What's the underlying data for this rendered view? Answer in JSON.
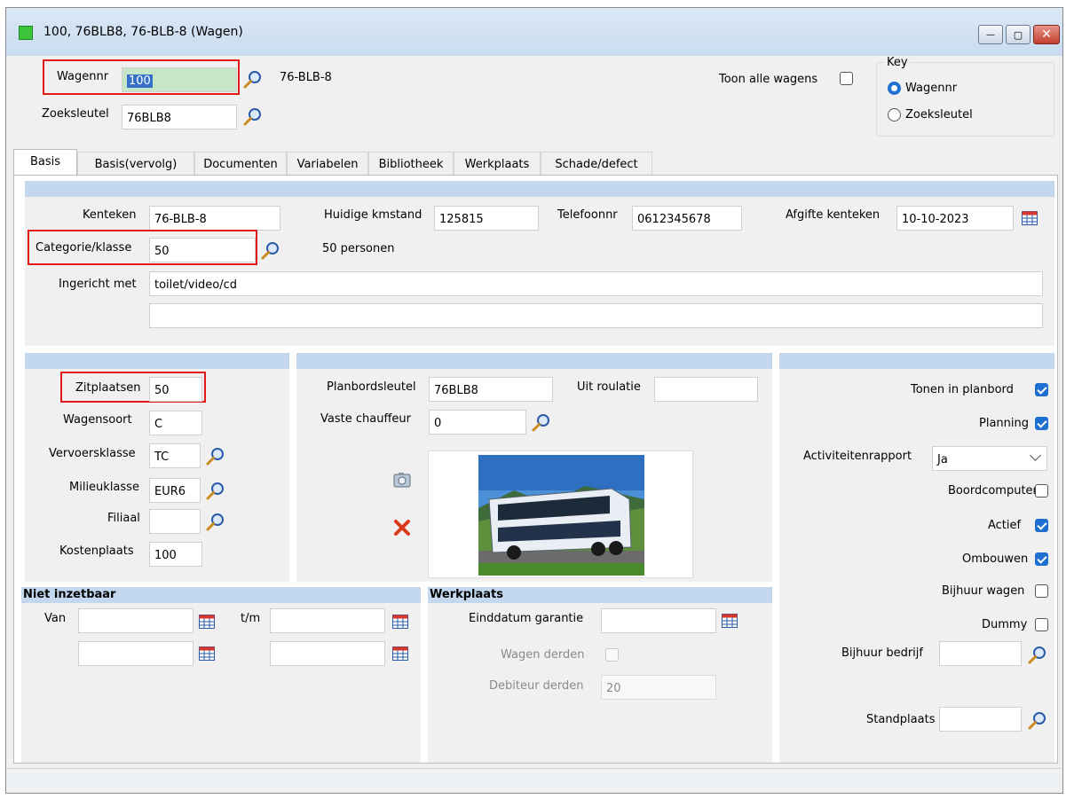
{
  "window": {
    "title": "100, 76BLB8, 76-BLB-8 (Wagen)",
    "minimize_glyph": "—",
    "maximize_glyph": "▢",
    "close_glyph": "✕"
  },
  "header": {
    "wagennr_label": "Wagennr",
    "wagennr_value": "100",
    "kenteken_display": "76-BLB-8",
    "zoeksleutel_label": "Zoeksleutel",
    "zoeksleutel_value": "76BLB8",
    "toon_alle_wagens_label": "Toon alle wagens",
    "toon_alle_wagens_checked": false,
    "key_group_label": "Key",
    "key_options": [
      {
        "label": "Wagennr",
        "selected": true
      },
      {
        "label": "Zoeksleutel",
        "selected": false
      }
    ]
  },
  "tabs": [
    "Basis",
    "Basis(vervolg)",
    "Documenten",
    "Variabelen",
    "Bibliotheek",
    "Werkplaats",
    "Schade/defect"
  ],
  "active_tab": "Basis",
  "top_section": {
    "kenteken_label": "Kenteken",
    "kenteken_value": "76-BLB-8",
    "kmstand_label": "Huidige kmstand",
    "kmstand_value": "125815",
    "telefoonnr_label": "Telefoonnr",
    "telefoonnr_value": "0612345678",
    "afgifte_label": "Afgifte kenteken",
    "afgifte_value": "10-10-2023",
    "categorie_label": "Categorie/klasse",
    "categorie_value": "50",
    "categorie_desc": "50 personen",
    "ingericht_label": "Ingericht met",
    "ingericht_value": "toilet/video/cd",
    "ingericht_value2": ""
  },
  "left_section": {
    "zitplaatsen_label": "Zitplaatsen",
    "zitplaatsen_value": "50",
    "wagensoort_label": "Wagensoort",
    "wagensoort_value": "C",
    "vervoersklasse_label": "Vervoersklasse",
    "vervoersklasse_value": "TC",
    "milieuklasse_label": "Milieuklasse",
    "milieuklasse_value": "EUR6",
    "filiaal_label": "Filiaal",
    "filiaal_value": "",
    "kostenplaats_label": "Kostenplaats",
    "kostenplaats_value": "100"
  },
  "middle_section": {
    "planbordsleutel_label": "Planbordsleutel",
    "planbordsleutel_value": "76BLB8",
    "uit_roulatie_label": "Uit roulatie",
    "uit_roulatie_value": "",
    "vaste_chauffeur_label": "Vaste chauffeur",
    "vaste_chauffeur_value": "0"
  },
  "right_section": {
    "items": [
      {
        "label": "Tonen in planbord",
        "checked": true
      },
      {
        "label": "Planning",
        "checked": true
      }
    ],
    "activiteitenrapport_label": "Activiteitenrapport",
    "activiteitenrapport_value": "Ja",
    "items2": [
      {
        "label": "Boordcomputer",
        "checked": false
      },
      {
        "label": "Actief",
        "checked": true
      },
      {
        "label": "Ombouwen",
        "checked": true
      },
      {
        "label": "Bijhuur wagen",
        "checked": false
      },
      {
        "label": "Dummy",
        "checked": false
      }
    ],
    "bijhuur_bedrijf_label": "Bijhuur bedrijf",
    "bijhuur_bedrijf_value": "",
    "standplaats_label": "Standplaats",
    "standplaats_value": ""
  },
  "niet_inzetbaar": {
    "title": "Niet inzetbaar",
    "van_label": "Van",
    "tm_label": "t/m",
    "van1": "",
    "tm1": "",
    "van2": "",
    "tm2": ""
  },
  "werkplaats": {
    "title": "Werkplaats",
    "einddatum_label": "Einddatum garantie",
    "einddatum_value": "",
    "wagen_derden_label": "Wagen derden",
    "wagen_derden_checked": false,
    "debiteur_derden_label": "Debiteur derden",
    "debiteur_derden_value": "20"
  },
  "colors": {
    "accent": "#1f6fd1",
    "section_bar": "#c3d8ee",
    "highlight_box": "#e01818",
    "delete_x": "#d93a1a"
  }
}
